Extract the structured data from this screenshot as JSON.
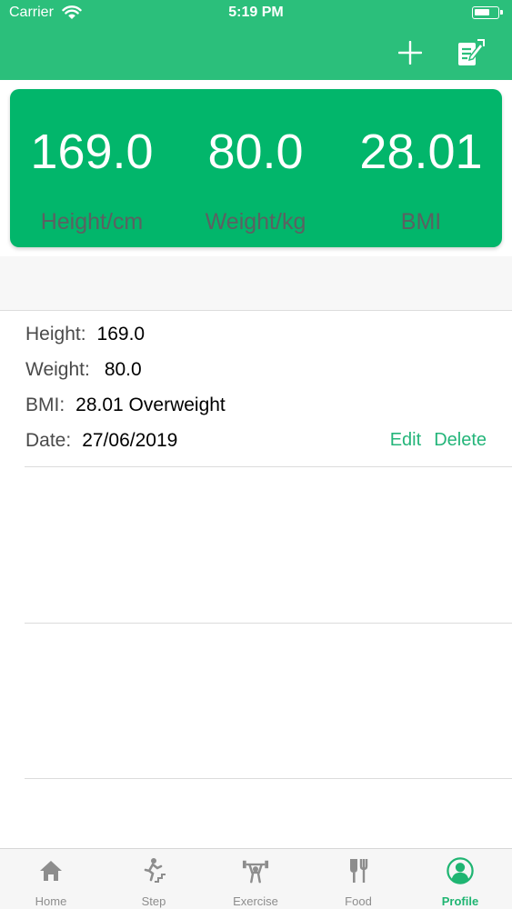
{
  "status_bar": {
    "carrier": "Carrier",
    "time": "5:19 PM"
  },
  "nav": {
    "icons": [
      "plus-icon",
      "note-edit-icon"
    ]
  },
  "stats": [
    {
      "value": "169.0",
      "label": "Height/cm"
    },
    {
      "value": "80.0",
      "label": "Weight/kg"
    },
    {
      "value": "28.01",
      "label": "BMI"
    }
  ],
  "record": {
    "height_label": "Height:",
    "height_value": "169.0",
    "weight_label": "Weight:",
    "weight_value": "80.0",
    "bmi_label": "BMI:",
    "bmi_value": "28.01 Overweight",
    "date_label": "Date:",
    "date_value": "27/06/2019",
    "edit_label": "Edit",
    "delete_label": "Delete"
  },
  "tabs": [
    {
      "label": "Home",
      "icon": "home-icon"
    },
    {
      "label": "Step",
      "icon": "step-icon"
    },
    {
      "label": "Exercise",
      "icon": "exercise-icon"
    },
    {
      "label": "Food",
      "icon": "food-icon"
    },
    {
      "label": "Profile",
      "icon": "profile-icon",
      "active": true
    }
  ],
  "colors": {
    "header": "#2bbf7b",
    "card": "#02b66b",
    "accent": "#1fb572",
    "inactive": "#8d8d8d"
  }
}
